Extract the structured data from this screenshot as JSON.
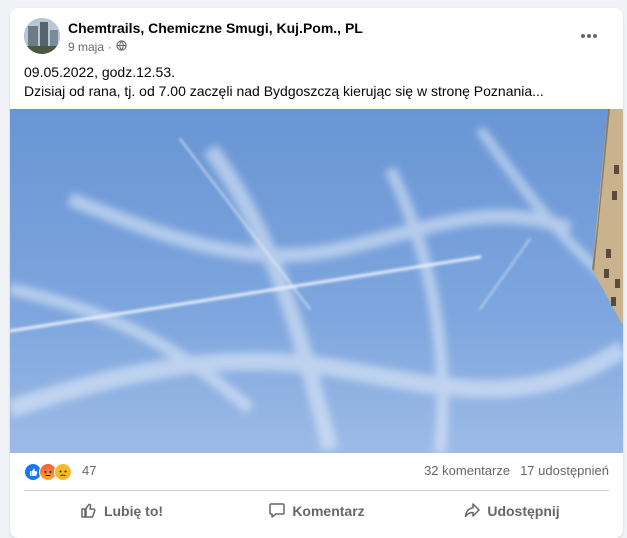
{
  "post": {
    "author": "Chemtrails, Chemiczne Smugi, Kuj.Pom., PL",
    "date": "9 maja",
    "audience_icon": "globe-icon",
    "line1": "09.05.2022, godz.12.53.",
    "line2": "Dzisiaj od rana, tj. od 7.00 zaczęli nad Bydgoszczą kierując się w stronę Poznania..."
  },
  "stats": {
    "reactions": [
      "like-reaction",
      "angry-reaction",
      "sad-reaction"
    ],
    "reaction_count": "47",
    "comments": "32 komentarze",
    "shares": "17 udostępnień"
  },
  "actions": {
    "like": "Lubię to!",
    "comment": "Komentarz",
    "share": "Udostępnij"
  },
  "colors": {
    "sky_top": "#6e99d6",
    "sky_bottom": "#8fb3e6",
    "like_blue": "#1877f2",
    "angry_orange": "#f0582d",
    "sad_yellow": "#f7b928"
  }
}
